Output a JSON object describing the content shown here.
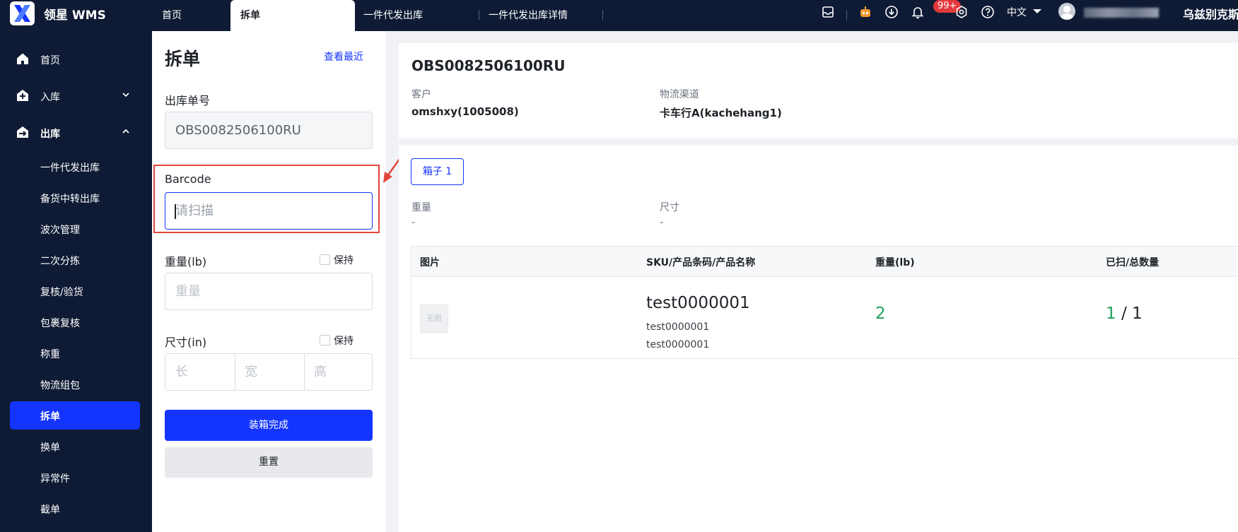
{
  "app": {
    "brand": "领星 WMS"
  },
  "topbar": {
    "tabs": [
      {
        "label": "首页"
      },
      {
        "label": "拆单"
      },
      {
        "label": "一件代发出库"
      },
      {
        "label": "一件代发出库详情"
      }
    ],
    "notification_badge": "99+",
    "language": "中文",
    "user_right_text": "乌兹别克斯"
  },
  "sidebar": {
    "items": [
      {
        "label": "首页",
        "icon": "home-icon"
      },
      {
        "label": "入库",
        "icon": "inbound-icon"
      },
      {
        "label": "出库",
        "icon": "outbound-icon"
      },
      {
        "label": "一件代发出库"
      },
      {
        "label": "备货中转出库"
      },
      {
        "label": "波次管理"
      },
      {
        "label": "二次分拣"
      },
      {
        "label": "复核/验货"
      },
      {
        "label": "包裹复核"
      },
      {
        "label": "称重"
      },
      {
        "label": "物流组包"
      },
      {
        "label": "拆单"
      },
      {
        "label": "换单"
      },
      {
        "label": "异常件"
      },
      {
        "label": "截单"
      }
    ]
  },
  "form": {
    "title": "拆单",
    "recent_link": "查看最近",
    "order_no_label": "出库单号",
    "order_no_value": "OBS0082506100RU",
    "barcode_label": "Barcode",
    "barcode_placeholder": "请扫描",
    "weight_label": "重量(lb)",
    "weight_placeholder": "重量",
    "weight_keep": "保持",
    "size_label": "尺寸(in)",
    "size_keep": "保持",
    "length_placeholder": "长",
    "width_placeholder": "宽",
    "height_placeholder": "高",
    "finish_button": "装箱完成",
    "reset_button": "重置"
  },
  "order": {
    "number": "OBS0082506100RU",
    "customer_label": "客户",
    "customer_value": "omshxy(1005008)",
    "channel_label": "物流渠道",
    "channel_value": "卡车行A(kachehang1)"
  },
  "box": {
    "tag": "箱子 1",
    "weight_label": "重量",
    "weight_value": "-",
    "size_label": "尺寸",
    "size_value": "-"
  },
  "table": {
    "headers": [
      "图片",
      "SKU/产品条码/产品名称",
      "重量(lb)",
      "已扫/总数量"
    ],
    "rows": [
      {
        "image": "无图",
        "sku": "test0000001",
        "barcode": "test0000001",
        "name": "test0000001",
        "weight": "2",
        "scanned": "1",
        "separator": "/",
        "total": "1"
      }
    ]
  },
  "colors": {
    "primary": "#1434ff",
    "nav_bg": "#0f1b34",
    "success": "#1da35a",
    "annotation": "#e0463c"
  }
}
